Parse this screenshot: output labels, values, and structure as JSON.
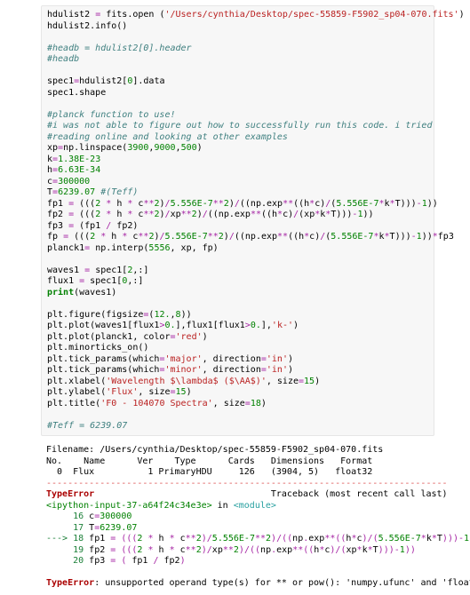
{
  "code": {
    "l01a": "hdulist2 ",
    "l01b": " fits.open (",
    "l01c": "'/Users/cynthia/Desktop/spec-55859-F5902_sp04-070.fits'",
    "l01d": ")",
    "l02": "hdulist2.info()",
    "l03": "",
    "l04": "#headb = hdulist2[0].header",
    "l05": "#headb",
    "l06": "",
    "l07a": "spec1",
    "l07b": "hdulist2[",
    "l07c": "0",
    "l07d": "].data",
    "l08": "spec1.shape",
    "l09": "",
    "l10": "#planck function to use!",
    "l11": "#i was not able to figure out how to successfully run this code. i tried",
    "l12": "#reading online and looking at other examples",
    "l13a": "xp",
    "l13b": "np.linspace(",
    "l13c": "3900",
    "l13d": ",",
    "l13e": "9000",
    "l13f": ",",
    "l13g": "500",
    "l13h": ")",
    "l14a": "k",
    "l14b": "1.38E-23",
    "l15a": "h",
    "l15b": "6.63E-34",
    "l16a": "c",
    "l16b": "300000",
    "l17a": "T",
    "l17b": "6239.07",
    "l17c": " #(Teff)",
    "l18a": "fp1 ",
    "l18b": " (((",
    "l18c": "2",
    "l18d": " h ",
    "l18e": " c",
    "l18f": "2",
    "l18g": ")",
    "l18h": "5.556E-7",
    "l18i": "2",
    "l18j": ")",
    "l18k": "((np.exp",
    "l18l": "((h",
    "l18m": "c)",
    "l18n": "(",
    "l18o": "5.556E-7",
    "l18p": "k",
    "l18q": "T)))",
    "l18r": "1",
    "l18s": "))",
    "l19a": "fp2 ",
    "l19b": " (((",
    "l19e": " c",
    "l19f": "2",
    "l19g": ")",
    "l19h": "xp",
    "l19i": "2",
    "l19j": ")",
    "l19k": "((np.exp",
    "l19l": "((h",
    "l19m": "c)",
    "l19n": "(xp",
    "l19p": "k",
    "l19q": "T)))",
    "l19r": "1",
    "l19s": "))",
    "l20a": "fp3 ",
    "l20b": " (fp1 ",
    "l20c": " fp2)",
    "l21a": "fp ",
    "l21b": " (((",
    "l21s": "))",
    "l21t": "fp3",
    "l22a": "planck1",
    "l22b": " np.interp(",
    "l22c": "5556",
    "l22d": ", xp, fp)",
    "l23": "",
    "l24a": "waves1 ",
    "l24b": " spec1[",
    "l24c": "2",
    "l24d": ",:]",
    "l25a": "flux1 ",
    "l25b": " spec1[",
    "l25c": "0",
    "l25d": ",:]",
    "l26a": "print",
    "l26b": "(waves1)",
    "l27": "",
    "l28a": "plt.figure(figsize",
    "l28b": "(",
    "l28c": "12.",
    "l28d": ",",
    "l28e": "8",
    "l28f": "))",
    "l29a": "plt.plot(waves1[flux1",
    "l29b": "0.",
    "l29c": "],flux1[flux1",
    "l29d": "0.",
    "l29e": "],",
    "l29f": "'k-'",
    "l29g": ")",
    "l30a": "plt.plot(planck1, color",
    "l30b": "'red'",
    "l30c": ")",
    "l31": "plt.minorticks_on()",
    "l32a": "plt.tick_params(which",
    "l32b": "'major'",
    "l32c": ", direction",
    "l32d": "'in'",
    "l32e": ")",
    "l33a": "plt.tick_params(which",
    "l33b": "'minor'",
    "l33c": ", direction",
    "l33d": "'in'",
    "l33e": ")",
    "l34a": "plt.xlabel(",
    "l34b": "'Wavelength $\\lambda$ ($\\AA$)'",
    "l34c": ", size",
    "l34d": "15",
    "l34e": ")",
    "l35a": "plt.ylabel(",
    "l35b": "'Flux'",
    "l35c": ", size",
    "l35d": "15",
    "l35e": ")",
    "l36a": "plt.title(",
    "l36b": "'F0 - 104070 Spectra'",
    "l36c": ", size",
    "l36d": "18",
    "l36e": ")",
    "l37": "",
    "l38": "#Teff = 6239.07"
  },
  "out": {
    "fileinfo1": "Filename: /Users/cynthia/Desktop/spec-55859-F5902_sp04-070.fits",
    "fileinfo2": "No.    Name      Ver    Type      Cards   Dimensions   Format",
    "fileinfo3": "  0  Flux          1 PrimaryHDU     126   (3904, 5)   float32",
    "sep": "---------------------------------------------------------------------------",
    "errtype": "TypeError",
    "tbhead": "                                 Traceback (most recent call last)",
    "ipyline": "<ipython-input-37-a64f24c34e3e>",
    "inmod": " in ",
    "module": "<module>",
    "f16a": "     16 ",
    "f16b": "c",
    "f16c": "=",
    "f16d": "300000",
    "f17a": "     17 ",
    "f17b": "T",
    "f17c": "=",
    "f17d": "6239.07",
    "f18a": "---> 18 ",
    "f18b": "fp1 ",
    "f18c": "=",
    "f19a": "     19 ",
    "f19b": "fp2 ",
    "f20a": "     20 ",
    "f20b": "fp3 ",
    "f20c": " fp1 ",
    "f20d": " fp2",
    "errmsg": ": unsupported operand type(s) for ** or pow(): 'numpy.ufunc' and 'float'"
  }
}
